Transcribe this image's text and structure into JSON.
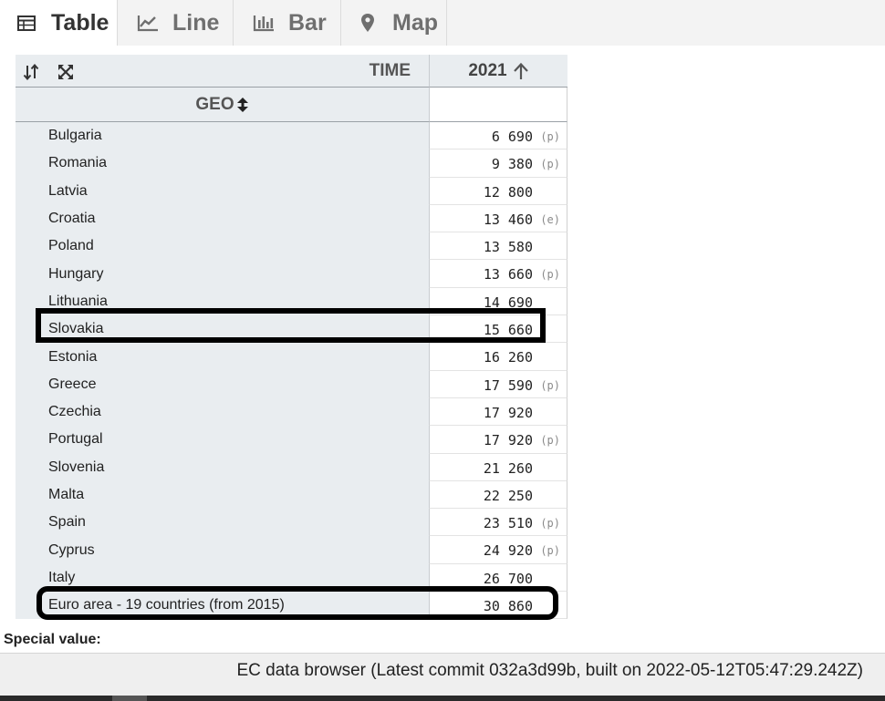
{
  "tabs": [
    {
      "label": "Table",
      "icon": "table-icon",
      "active": true
    },
    {
      "label": "Line",
      "icon": "line-chart-icon",
      "active": false
    },
    {
      "label": "Bar",
      "icon": "bar-chart-icon",
      "active": false
    },
    {
      "label": "Map",
      "icon": "map-marker-icon",
      "active": false
    }
  ],
  "table": {
    "time_header": "TIME",
    "year_header": "2021",
    "geo_header": "GEO",
    "rows": [
      {
        "geo": "Bulgaria",
        "value": "6 690",
        "flag": "(p)"
      },
      {
        "geo": "Romania",
        "value": "9 380",
        "flag": "(p)"
      },
      {
        "geo": "Latvia",
        "value": "12 800",
        "flag": ""
      },
      {
        "geo": "Croatia",
        "value": "13 460",
        "flag": "(e)"
      },
      {
        "geo": "Poland",
        "value": "13 580",
        "flag": ""
      },
      {
        "geo": "Hungary",
        "value": "13 660",
        "flag": "(p)"
      },
      {
        "geo": "Lithuania",
        "value": "14 690",
        "flag": ""
      },
      {
        "geo": "Slovakia",
        "value": "15 660",
        "flag": "",
        "highlight": true
      },
      {
        "geo": "Estonia",
        "value": "16 260",
        "flag": ""
      },
      {
        "geo": "Greece",
        "value": "17 590",
        "flag": "(p)"
      },
      {
        "geo": "Czechia",
        "value": "17 920",
        "flag": ""
      },
      {
        "geo": "Portugal",
        "value": "17 920",
        "flag": "(p)"
      },
      {
        "geo": "Slovenia",
        "value": "21 260",
        "flag": ""
      },
      {
        "geo": "Malta",
        "value": "22 250",
        "flag": ""
      },
      {
        "geo": "Spain",
        "value": "23 510",
        "flag": "(p)"
      },
      {
        "geo": "Cyprus",
        "value": "24 920",
        "flag": "(p)"
      },
      {
        "geo": "Italy",
        "value": "26 700",
        "flag": ""
      },
      {
        "geo": "Euro area - 19 countries (from 2015)",
        "value": "30 860",
        "flag": "",
        "highlight": true
      }
    ]
  },
  "special_value_label": "Special value:",
  "footer": {
    "text": "EC data browser (Latest commit 032a3d99b, built on 2022-05-12T05:47:29.242Z)"
  },
  "colors": {
    "header_bg": "#e9edf0",
    "tab_bg": "#f3f3f3",
    "highlight": "#000000"
  }
}
